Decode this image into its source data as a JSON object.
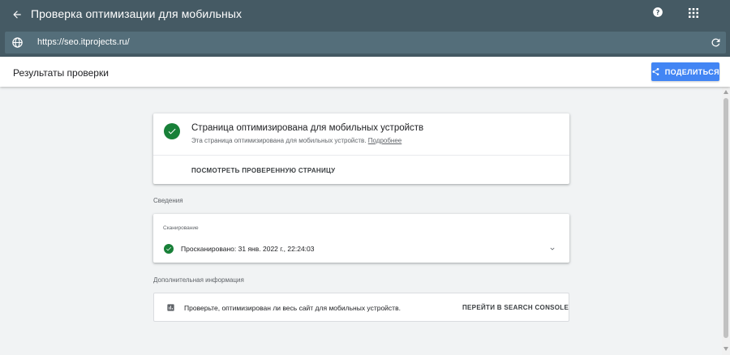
{
  "header": {
    "title": "Проверка оптимизации для мобильных",
    "url": "https://seo.itprojects.ru/"
  },
  "subheader": {
    "title": "Результаты проверки",
    "share_label": "ПОДЕЛИТЬСЯ"
  },
  "result": {
    "title": "Страница оптимизирована для мобильных устройств",
    "description": "Эта страница оптимизирована для мобильных устройств.",
    "more_link": "Подробнее",
    "view_button": "ПОСМОТРЕТЬ ПРОВЕРЕННУЮ СТРАНИЦУ"
  },
  "details": {
    "section_label": "Сведения",
    "crawl_subtitle": "Сканирование",
    "crawl_status": "Просканировано: 31 янв. 2022 г., 22:24:03"
  },
  "extra": {
    "section_label": "Дополнительная информация",
    "text": "Проверьте, оптимизирован ли весь сайт для мобильных устройств.",
    "console_button": "ПЕРЕЙТИ В SEARCH CONSOLE"
  },
  "colors": {
    "appbar": "#455a64",
    "urlbar": "#546e7a",
    "accent": "#4285f4",
    "success": "#188038"
  },
  "icons": [
    "arrow-back-icon",
    "help-icon",
    "apps-grid-icon",
    "globe-icon",
    "reload-icon",
    "share-icon",
    "check-circle-icon",
    "chevron-down-icon",
    "bar-chart-icon"
  ]
}
